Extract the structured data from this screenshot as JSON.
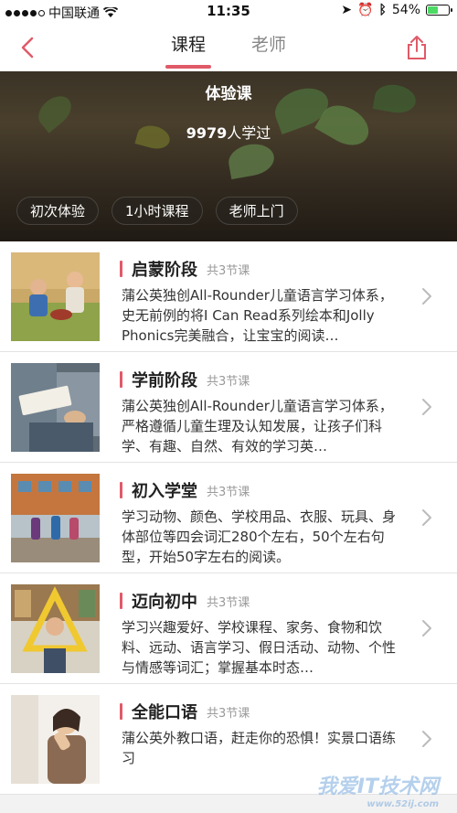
{
  "status": {
    "carrier": "中国联通",
    "time": "11:35",
    "battery": "54%",
    "battery_level": 0.54
  },
  "nav": {
    "tabs": [
      {
        "label": "课程",
        "active": true
      },
      {
        "label": "老师",
        "active": false
      }
    ]
  },
  "hero": {
    "title": "体验课",
    "count": "9979",
    "count_suffix": "人学过",
    "chips": [
      "初次体验",
      "1小时课程",
      "老师上门"
    ]
  },
  "courses": [
    {
      "title": "启蒙阶段",
      "count": "共3节课",
      "desc": "蒲公英独创All-Rounder儿童语言学习体系，史无前例的将I Can Read系列绘本和Jolly Phonics完美融合，让宝宝的阅读…",
      "thumb": "kids-on-grass"
    },
    {
      "title": "学前阶段",
      "count": "共3节课",
      "desc": "蒲公英独创All-Rounder儿童语言学习体系，严格遵循儿童生理及认知发展，让孩子们科学、有趣、自然、有效的学习英…",
      "thumb": "reading-book"
    },
    {
      "title": "初入学堂",
      "count": "共3节课",
      "desc": "学习动物、颜色、学校用品、衣服、玩具、身体部位等四会词汇280个左右，50个左右句型，开始50字左右的阅读。",
      "thumb": "kids-going-school"
    },
    {
      "title": "迈向初中",
      "count": "共3节课",
      "desc": "学习兴趣爱好、学校课程、家务、食物和饮料、远动、语言学习、假日活动、动物、个性与情感等词汇；掌握基本时态…",
      "thumb": "triangle-classroom"
    },
    {
      "title": "全能口语",
      "count": "共3节课",
      "desc": "蒲公英外教口语，赶走你的恐惧！实景口语练习",
      "thumb": "girl-thinking"
    }
  ],
  "watermark": {
    "text": "我爱IT技术网",
    "sub": "www.52ij.com"
  },
  "colors": {
    "accent": "#e05a68",
    "text": "#222222",
    "muted": "#999999"
  }
}
